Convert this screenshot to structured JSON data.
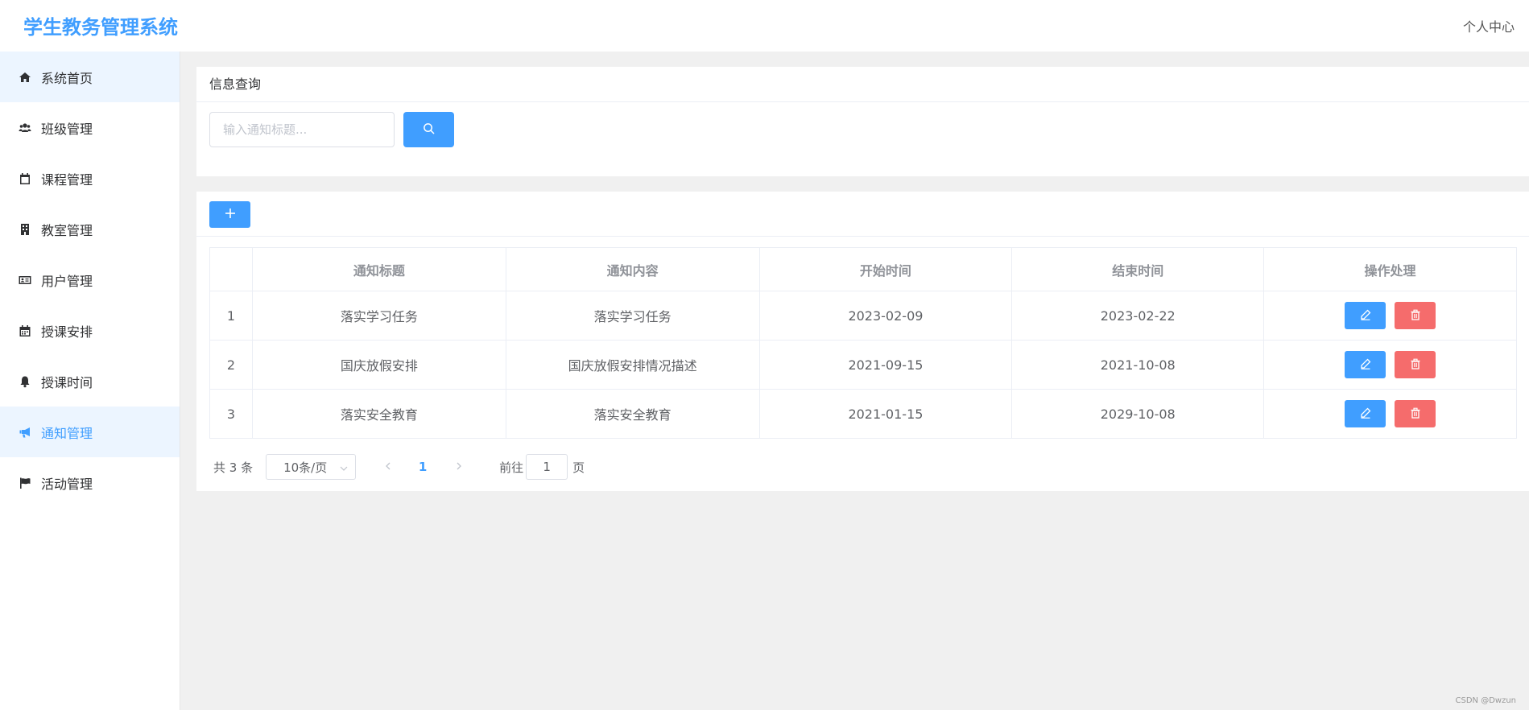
{
  "app": {
    "title": "学生教务管理系统",
    "user_center": "个人中心"
  },
  "sidebar": {
    "items": [
      {
        "label": "系统首页",
        "icon": "home-icon"
      },
      {
        "label": "班级管理",
        "icon": "users-icon"
      },
      {
        "label": "课程管理",
        "icon": "calendar-icon"
      },
      {
        "label": "教室管理",
        "icon": "building-icon"
      },
      {
        "label": "用户管理",
        "icon": "id-card-icon"
      },
      {
        "label": "授课安排",
        "icon": "calendar-schedule-icon"
      },
      {
        "label": "授课时间",
        "icon": "bell-icon"
      },
      {
        "label": "通知管理",
        "icon": "bullhorn-icon",
        "active": true
      },
      {
        "label": "活动管理",
        "icon": "flag-icon"
      }
    ]
  },
  "search": {
    "title": "信息查询",
    "placeholder": "输入通知标题..."
  },
  "table": {
    "headers": [
      "",
      "通知标题",
      "通知内容",
      "开始时间",
      "结束时间",
      "操作处理"
    ],
    "rows": [
      {
        "index": "1",
        "title": "落实学习任务",
        "content": "落实学习任务",
        "start": "2023-02-09",
        "end": "2023-02-22"
      },
      {
        "index": "2",
        "title": "国庆放假安排",
        "content": "国庆放假安排情况描述",
        "start": "2021-09-15",
        "end": "2021-10-08"
      },
      {
        "index": "3",
        "title": "落实安全教育",
        "content": "落实安全教育",
        "start": "2021-01-15",
        "end": "2029-10-08"
      }
    ]
  },
  "pagination": {
    "total": "共 3 条",
    "page_size": "10条/页",
    "current_page": "1",
    "goto_label": "前往",
    "goto_value": "1",
    "page_suffix": "页"
  },
  "watermark": "CSDN @Dwzun",
  "colors": {
    "primary": "#409eff",
    "danger": "#f56c6c",
    "active_bg": "#ecf5ff"
  }
}
